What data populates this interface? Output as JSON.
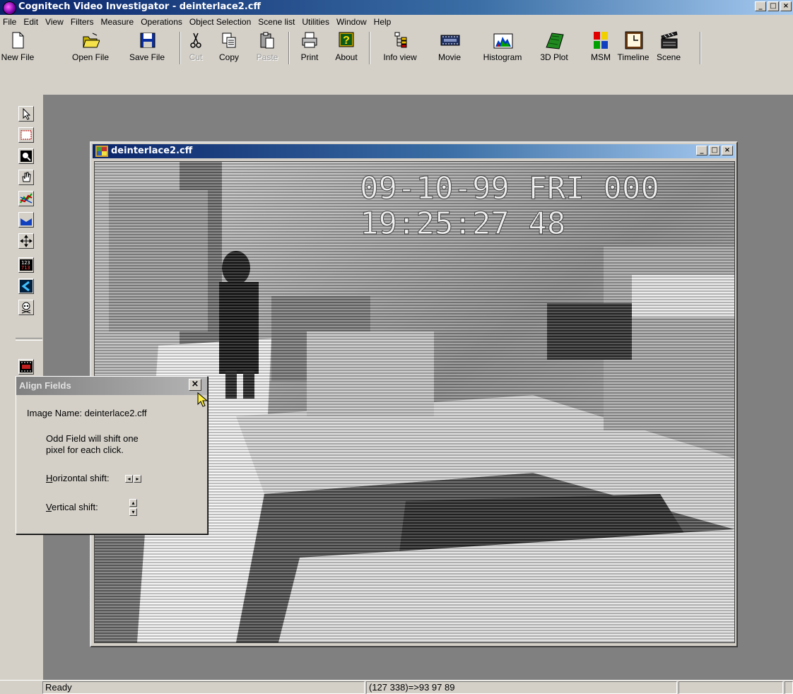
{
  "window": {
    "title": "Cognitech Video Investigator - deinterlace2.cff",
    "controls": [
      "_",
      "□",
      "×"
    ]
  },
  "menu": [
    "File",
    "Edit",
    "View",
    "Filters",
    "Measure",
    "Operations",
    "Object Selection",
    "Scene list",
    "Utilities",
    "Window",
    "Help"
  ],
  "toolbar": [
    {
      "label": "New File",
      "icon": "new-file-icon",
      "enabled": true
    },
    {
      "label": "Open File",
      "icon": "open-folder-icon",
      "enabled": true
    },
    {
      "label": "Save File",
      "icon": "floppy-disk-icon",
      "enabled": true
    },
    {
      "label": "Cut",
      "icon": "scissors-icon",
      "enabled": false
    },
    {
      "label": "Copy",
      "icon": "copy-icon",
      "enabled": true
    },
    {
      "label": "Paste",
      "icon": "clipboard-icon",
      "enabled": false
    },
    {
      "label": "Print",
      "icon": "printer-icon",
      "enabled": true
    },
    {
      "label": "About",
      "icon": "question-mark-icon",
      "enabled": true
    },
    {
      "label": "Info view",
      "icon": "tree-view-icon",
      "enabled": true
    },
    {
      "label": "Movie",
      "icon": "film-strip-icon",
      "enabled": true
    },
    {
      "label": "Histogram",
      "icon": "histogram-icon",
      "enabled": true
    },
    {
      "label": "3D Plot",
      "icon": "3d-plot-icon",
      "enabled": true
    },
    {
      "label": "MSM",
      "icon": "msm-grid-icon",
      "enabled": true
    },
    {
      "label": "Timeline",
      "icon": "timeline-clock-icon",
      "enabled": true
    },
    {
      "label": "Scene",
      "icon": "clapperboard-icon",
      "enabled": true
    }
  ],
  "left_tools": [
    "arrow-pointer-icon",
    "rectangle-select-icon",
    "zoom-icon",
    "hand-pan-icon",
    "line-profile-icon",
    "fill-icon",
    "move-icon",
    "numbers-icon",
    "kit-icon",
    "skull-icon",
    "film-icon"
  ],
  "child_window": {
    "title": "deinterlace2.cff",
    "controls": [
      "_",
      "□",
      "×"
    ],
    "overlay_line1": "09-10-99 FRI 000",
    "overlay_line2": "19:25:27 48"
  },
  "dialog": {
    "title": "Align Fields",
    "close": "×",
    "image_name": "Image Name: deinterlace2.cff",
    "note_line1": "Odd Field will shift one",
    "note_line2": "pixel for each click.",
    "horizontal_label_prefix": "H",
    "horizontal_label_rest": "orizontal shift:",
    "vertical_label_prefix": "V",
    "vertical_label_rest": "ertical shift:"
  },
  "status": {
    "text": "Ready",
    "coords": "(127 338)=>93 97 89"
  },
  "colors": {
    "active_title_start": "#0a246a",
    "active_title_end": "#a6caf0",
    "workspace": "#808080",
    "face": "#d4d0c8"
  }
}
